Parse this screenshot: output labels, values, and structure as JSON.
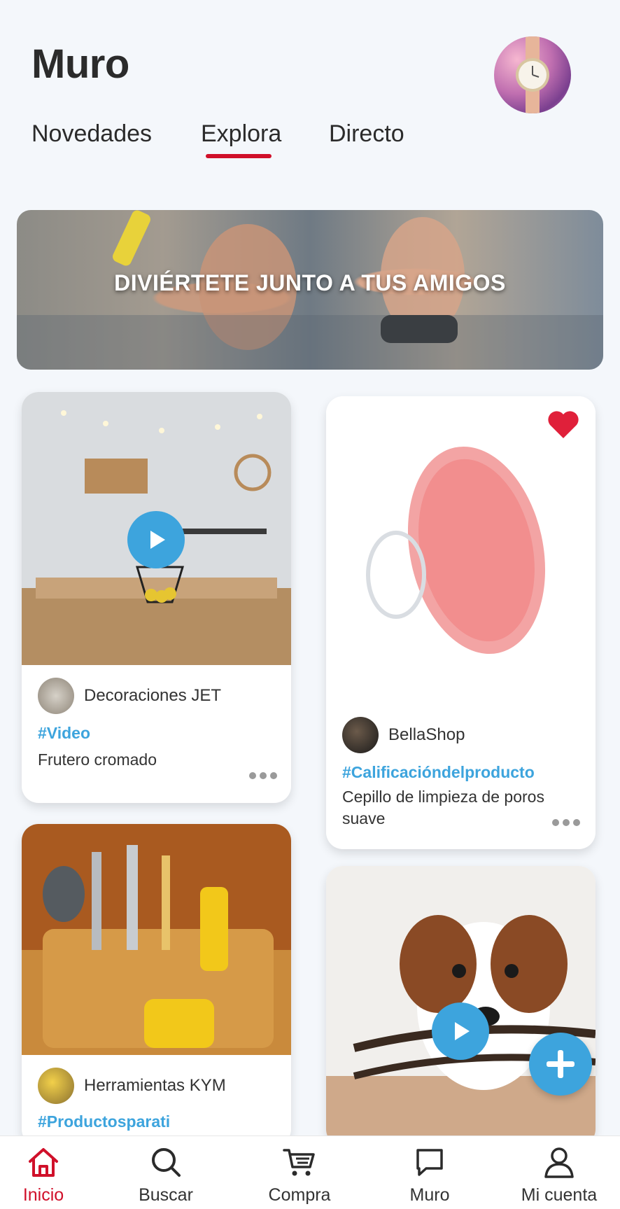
{
  "header": {
    "title": "Muro"
  },
  "tabs": [
    {
      "label": "Novedades",
      "active": false
    },
    {
      "label": "Explora",
      "active": true
    },
    {
      "label": "Directo",
      "active": false
    }
  ],
  "banner": {
    "text": "DIVIÉRTETE JUNTO A TUS AMIGOS"
  },
  "posts": [
    {
      "seller": "Decoraciones JET",
      "hashtag": "#Video",
      "description": "Frutero cromado",
      "has_video": true
    },
    {
      "seller": "BellaShop",
      "hashtag": "#Calificacióndelproducto",
      "description": "Cepillo de limpieza de poros suave",
      "favorited": true
    },
    {
      "seller": "Herramientas KYM",
      "hashtag": "#Productosparati"
    },
    {
      "has_video": true
    }
  ],
  "bottom_nav": {
    "items": [
      {
        "label": "Inicio",
        "icon": "home-icon",
        "active": true
      },
      {
        "label": "Buscar",
        "icon": "search-icon"
      },
      {
        "label": "Compra",
        "icon": "cart-icon"
      },
      {
        "label": "Muro",
        "icon": "chat-icon"
      },
      {
        "label": "Mi cuenta",
        "icon": "user-icon"
      }
    ]
  },
  "colors": {
    "accent_red": "#d0102a",
    "accent_blue": "#3da4dd",
    "background": "#f4f7fb"
  }
}
